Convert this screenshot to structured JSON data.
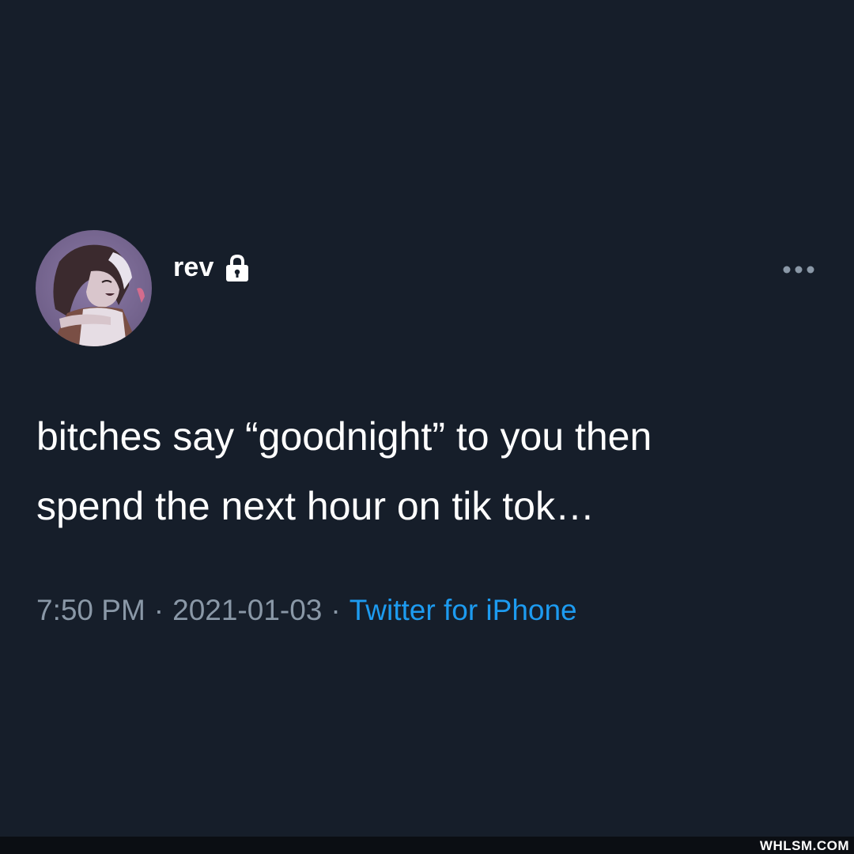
{
  "tweet": {
    "author": {
      "display_name": "rev",
      "verified_icon": "lock-icon",
      "avatar": "avatar-image"
    },
    "more_icon": "more-options-icon",
    "text_lines": [
      "bitches say “goodnight” to you then",
      "spend the next hour on tik tok…"
    ],
    "meta": {
      "time": "7:50 PM",
      "separator": "·",
      "date": "2021-01-03",
      "source": "Twitter for iPhone"
    }
  },
  "watermark": "WHLSM.COM",
  "colors": {
    "background": "#161e2a",
    "text": "#ffffff",
    "meta_text": "#8a98a7",
    "link": "#1d9bf0"
  }
}
